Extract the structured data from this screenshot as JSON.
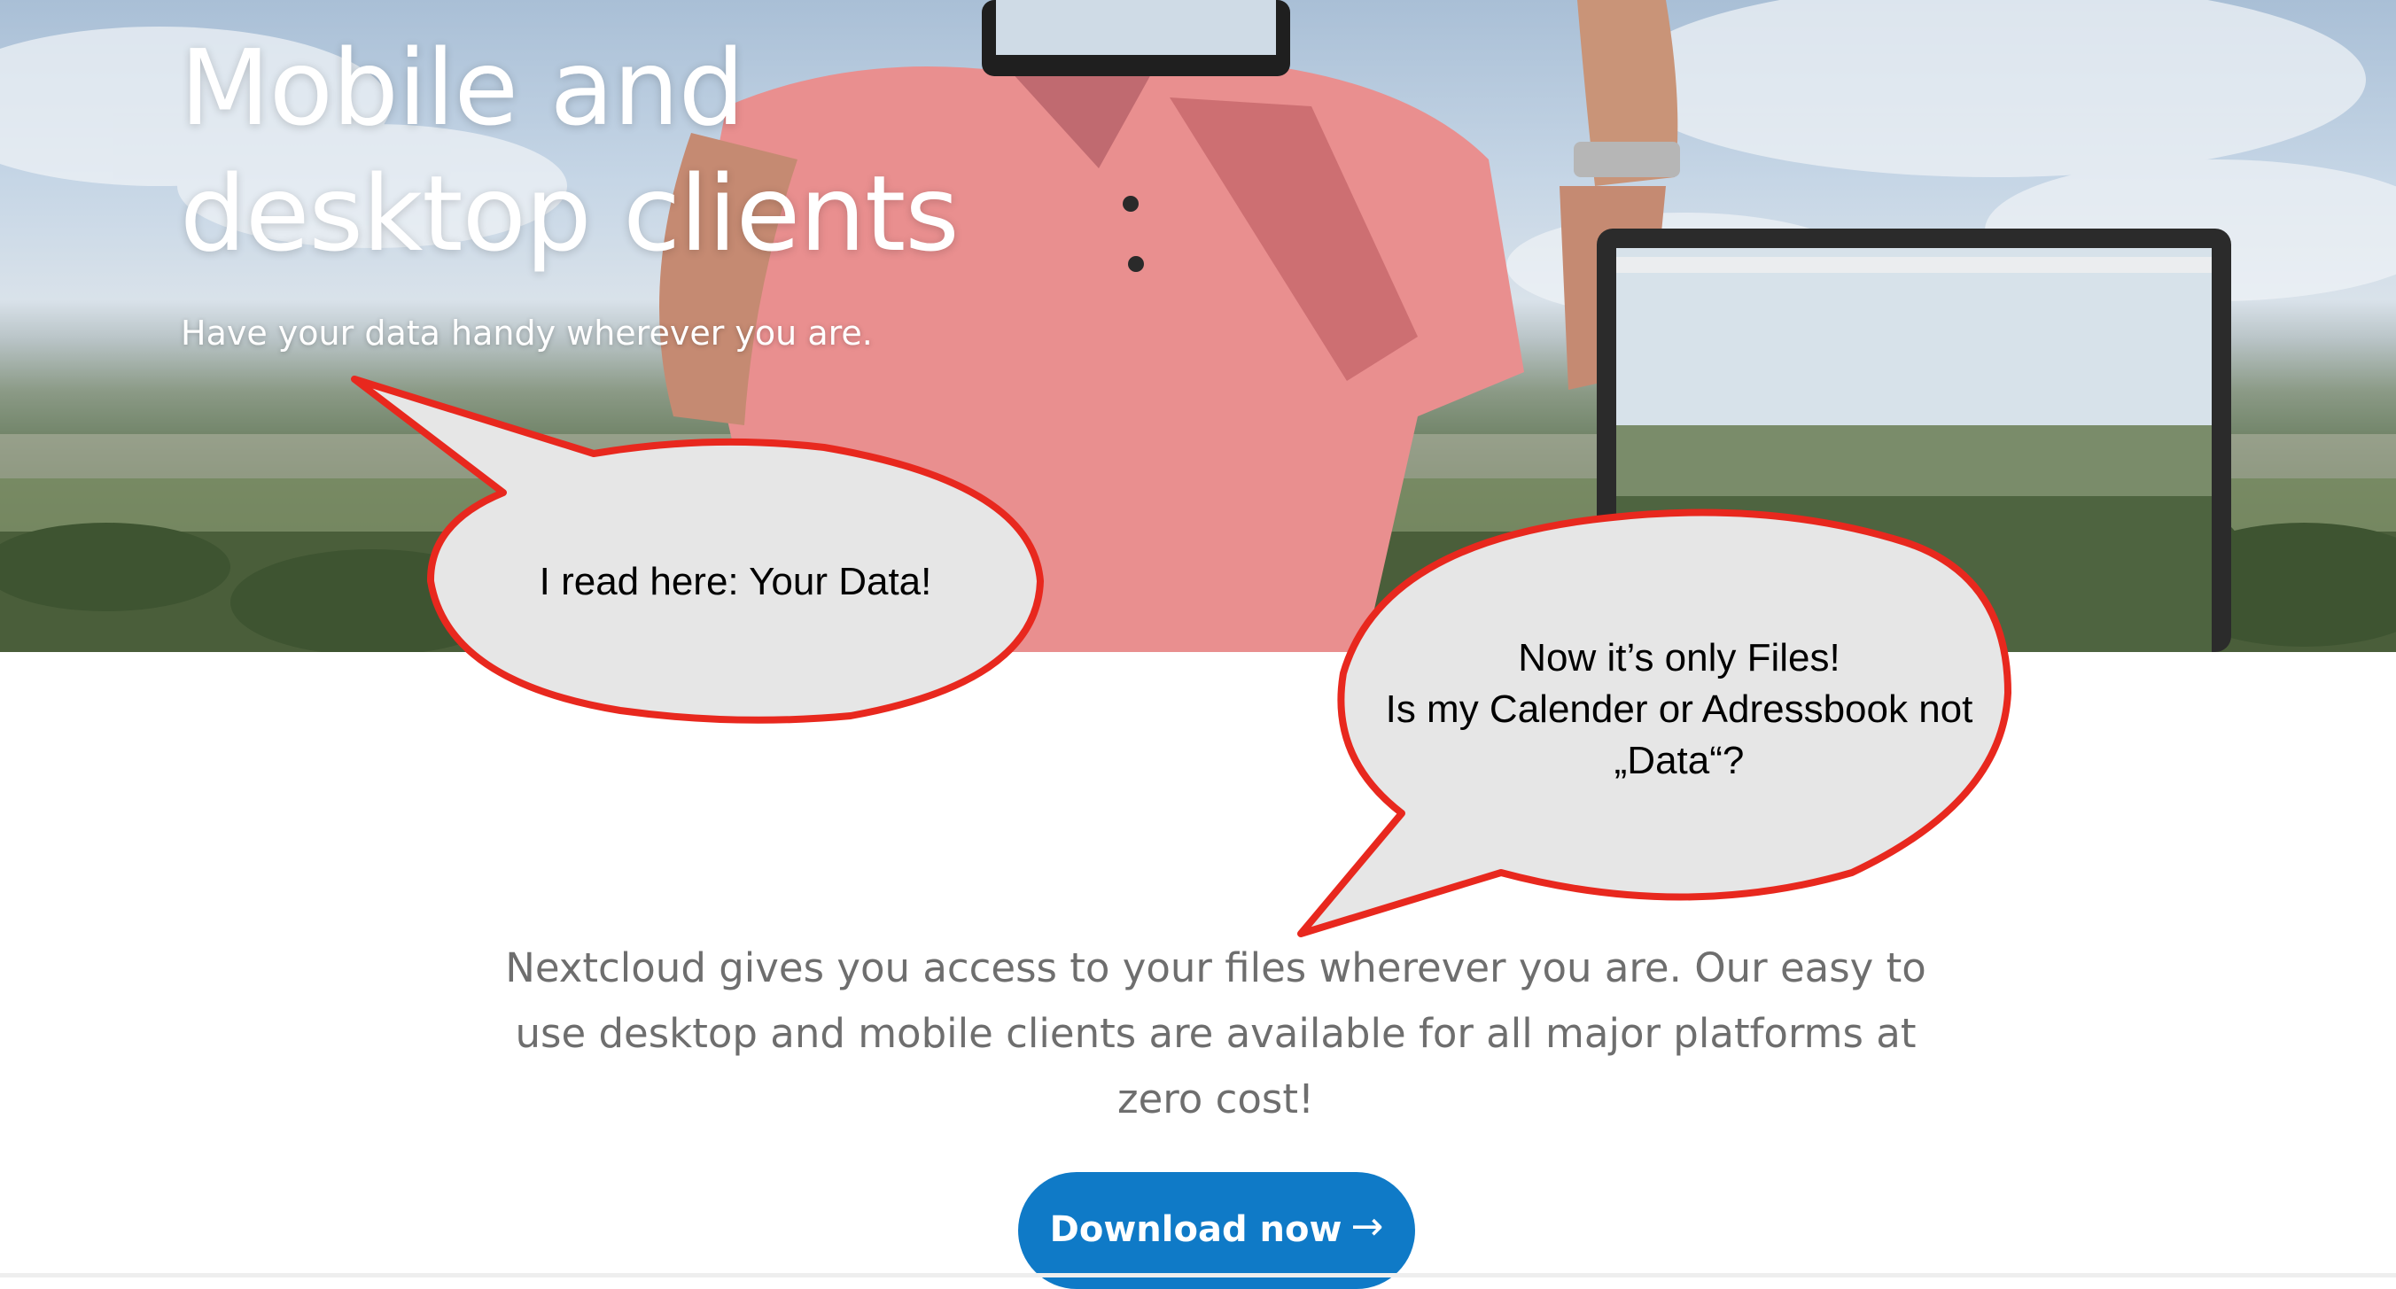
{
  "hero": {
    "title": "Mobile and\ndesktop clients",
    "subtitle": "Have your data handy wherever you are."
  },
  "intro": {
    "text": "Nextcloud gives you access to your files wherever you are. Our easy to use desktop and mobile clients are available for all major platforms at zero cost!"
  },
  "cta": {
    "label": "Download now",
    "arrow_icon": "→"
  },
  "annotations": {
    "bubble1": "I read here: Your Data!",
    "bubble2": "Now it’s only Files!\nIs my Calender or Adressbook not\n„Data“?"
  },
  "colors": {
    "button": "#0f7ac7",
    "bubble_fill": "#e6e6e6",
    "bubble_stroke": "#e8281e",
    "intro_text": "#6e6e6e"
  }
}
